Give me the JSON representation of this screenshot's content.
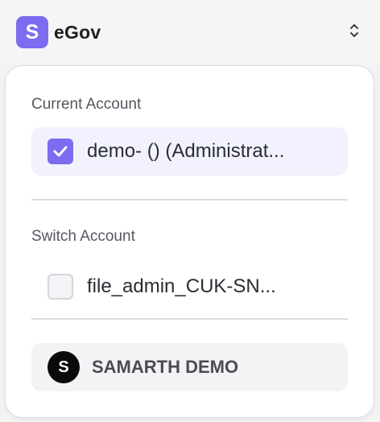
{
  "app": {
    "logo_letter": "S",
    "name": "eGov",
    "brand_color": "#7b6cf0"
  },
  "switcher_icon": "chevron-up-down-icon",
  "panel": {
    "current_label": "Current Account",
    "current_account": {
      "text": "demo- () (Administrat...",
      "checked": true
    },
    "switch_label": "Switch Account",
    "switch_accounts": [
      {
        "text": "file_admin_CUK-SN...",
        "checked": false
      }
    ],
    "organization": {
      "avatar_letter": "S",
      "name": "SAMARTH DEMO"
    }
  }
}
